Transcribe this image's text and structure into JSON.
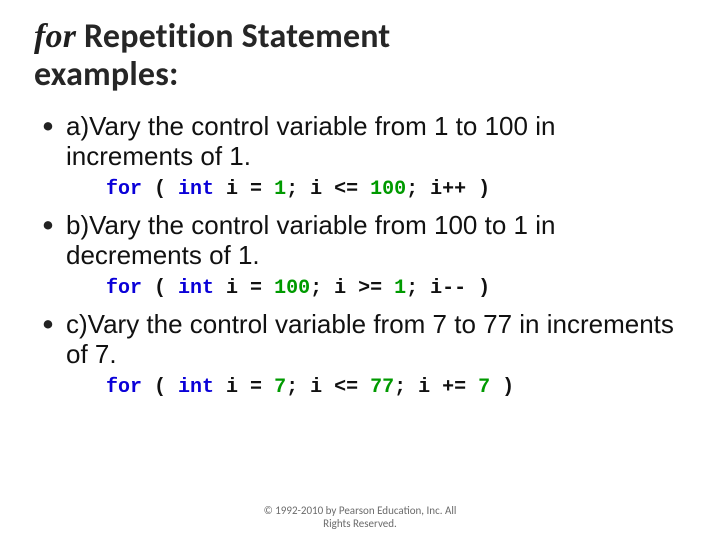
{
  "title": {
    "keyword": "for",
    "rest_line1": " Repetition Statement",
    "line2": "examples:"
  },
  "items": [
    {
      "desc": "a)Vary the control variable from 1 to 100 in increments of 1.",
      "code": {
        "kw1": "for",
        "p1": " ( ",
        "kw2": "int",
        "p2": " i = ",
        "n1": "1",
        "p3": "; i <= ",
        "n2": "100",
        "p4": "; i++ )"
      }
    },
    {
      "desc": "b)Vary the control variable from 100 to 1 in decrements of 1.",
      "code": {
        "kw1": "for",
        "p1": " ( ",
        "kw2": "int",
        "p2": " i = ",
        "n1": "100",
        "p3": "; i >= ",
        "n2": "1",
        "p4": "; i-- )"
      }
    },
    {
      "desc": "c)Vary the control variable from 7 to 77 in increments of 7.",
      "code": {
        "kw1": "for",
        "p1": " ( ",
        "kw2": "int",
        "p2": " i = ",
        "n1": "7",
        "p3": "; i <= ",
        "n2": "77",
        "p4": "; i += ",
        "n3": "7",
        "p5": " )"
      }
    }
  ],
  "footer": {
    "line1": "© 1992-2010 by Pearson Education, Inc. All",
    "line2": "Rights Reserved."
  }
}
